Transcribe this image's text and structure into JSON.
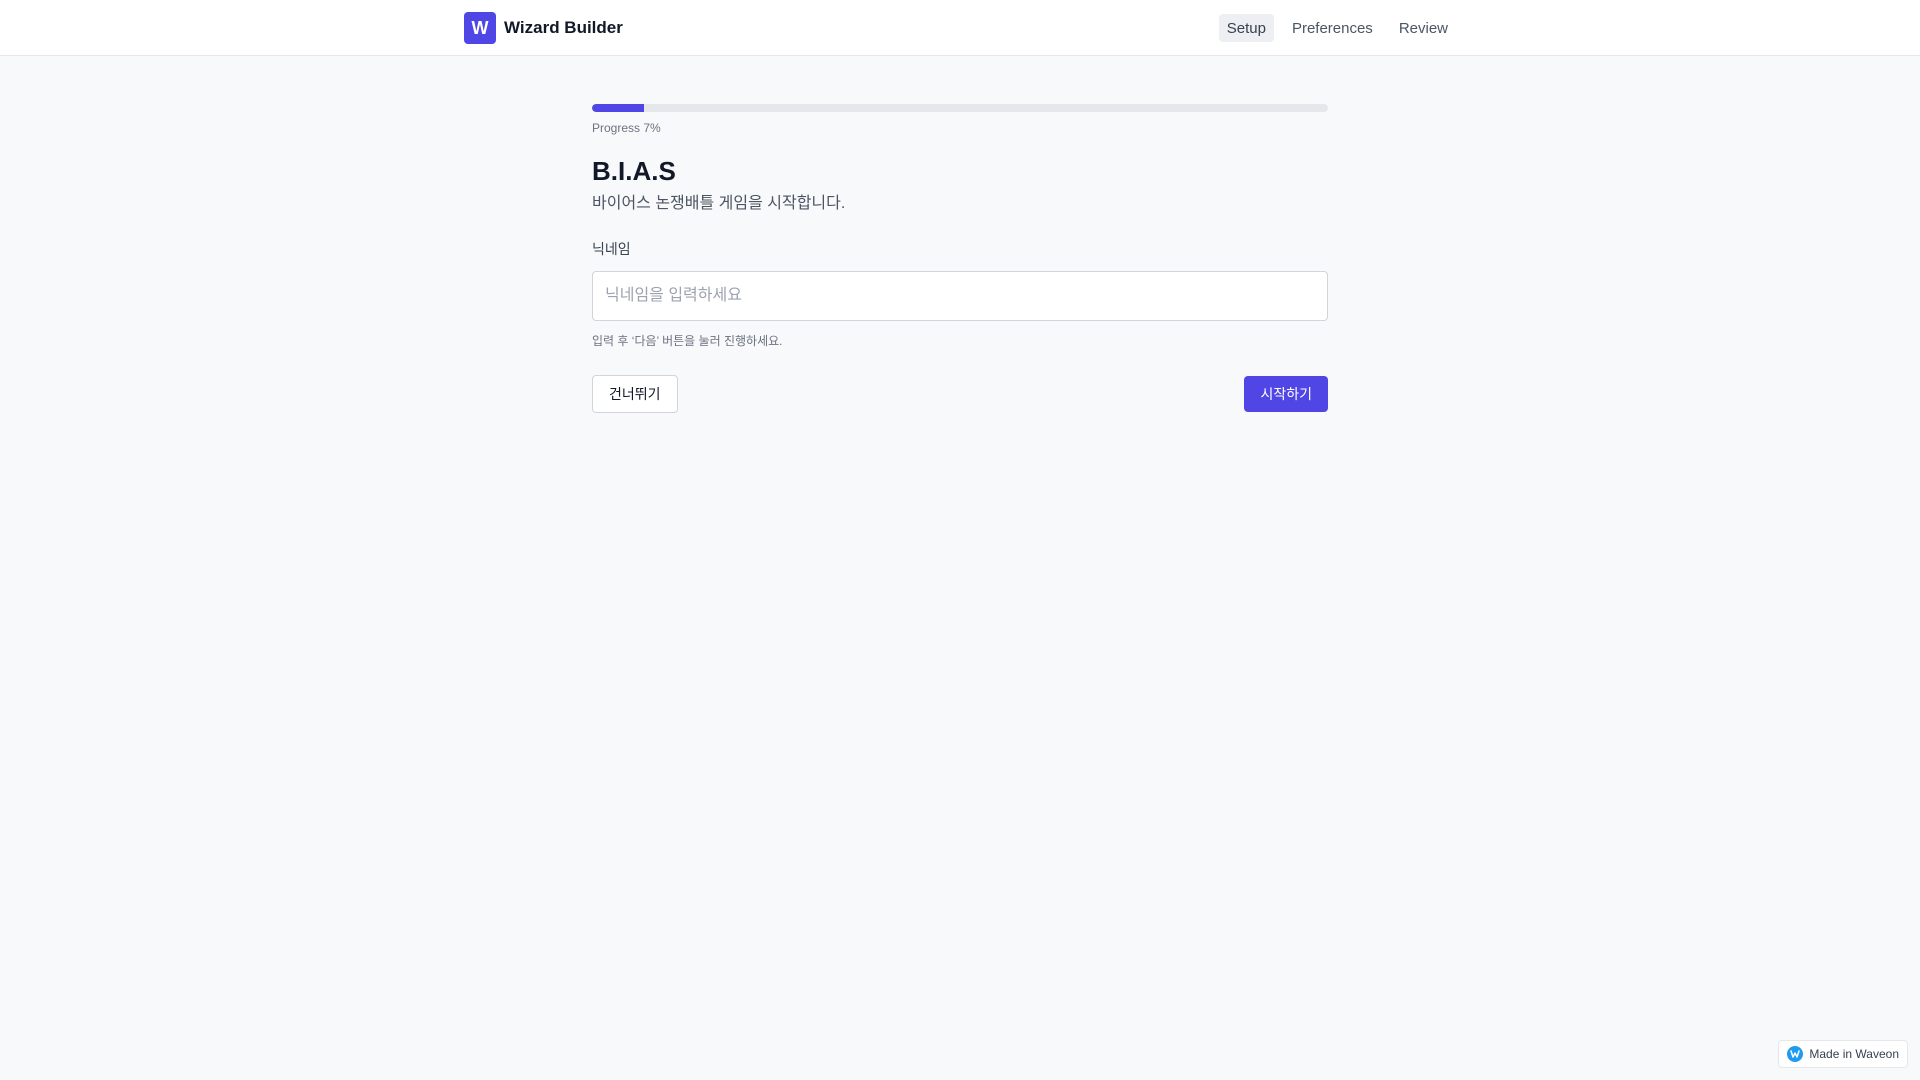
{
  "header": {
    "logo_letter": "W",
    "app_title": "Wizard Builder",
    "nav": [
      {
        "label": "Setup",
        "active": true
      },
      {
        "label": "Preferences",
        "active": false
      },
      {
        "label": "Review",
        "active": false
      }
    ]
  },
  "progress": {
    "percent": 7,
    "label": "Progress 7%"
  },
  "step": {
    "title": "B.I.A.S",
    "subtitle": "바이어스 논쟁배틀 게임을 시작합니다.",
    "field_label": "닉네임",
    "input_value": "",
    "input_placeholder": "닉네임을 입력하세요",
    "hint": "입력 후 ‘다음’ 버튼을 눌러 진행하세요."
  },
  "actions": {
    "skip_label": "건너뛰기",
    "start_label": "시작하기"
  },
  "badge": {
    "label": "Made in Waveon",
    "icon": "waveon-logo-icon"
  },
  "colors": {
    "accent": "#4f46e5",
    "background": "#f8f9fb",
    "badge_icon": "#1e9bf0"
  }
}
